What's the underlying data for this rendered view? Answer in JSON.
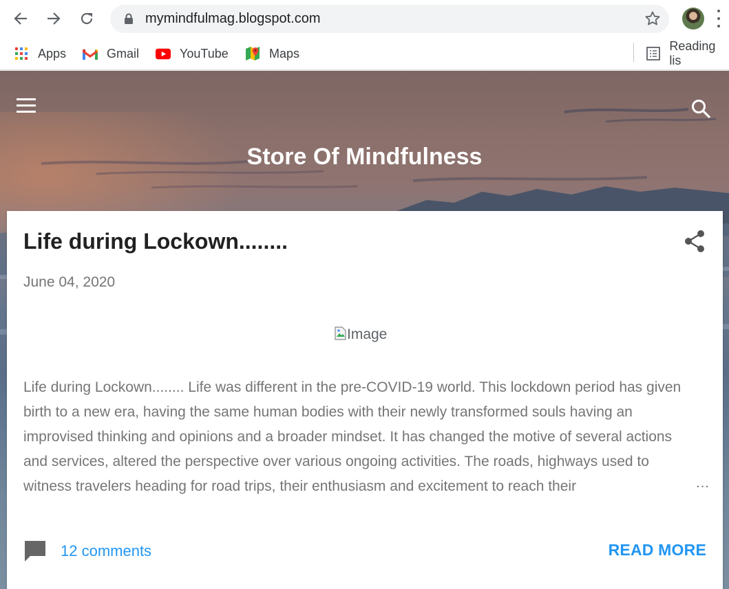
{
  "browser": {
    "url": "mymindfulmag.blogspot.com",
    "bookmarks": [
      {
        "label": "Apps",
        "icon": "apps-grid-icon"
      },
      {
        "label": "Gmail",
        "icon": "gmail-icon"
      },
      {
        "label": "YouTube",
        "icon": "youtube-icon"
      },
      {
        "label": "Maps",
        "icon": "maps-icon"
      }
    ],
    "reading_list": "Reading lis"
  },
  "blog": {
    "title": "Store Of Mindfulness"
  },
  "post": {
    "title": "Life during Lockown........",
    "date": "June 04, 2020",
    "image_alt": "Image",
    "snippet": "Life during Lockown........ Life was different in the pre-COVID-19 world. This lockdown period has given birth to a new era, having the same human bodies with their newly transformed souls having an improvised thinking and opinions and a broader mindset. It has changed the motive of several actions and services, altered the perspective over various ongoing activities. The roads, highways used to witness travelers heading for road trips, their enthusiasm and excitement to reach their",
    "ellipsis": "…",
    "comments": "12 comments",
    "read_more": "READ MORE"
  },
  "colors": {
    "accent": "#2196f3",
    "title_text": "#212121",
    "muted_text": "#757575"
  }
}
